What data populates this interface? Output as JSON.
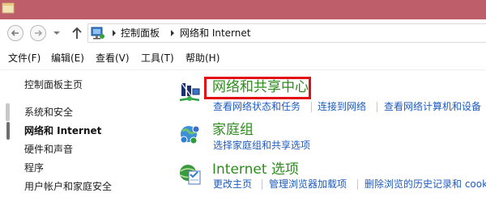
{
  "window": {
    "title_bar_color": "#bf5e6b"
  },
  "navigation": {
    "back_icon": "back-arrow-icon",
    "forward_icon": "forward-arrow-icon",
    "up_icon": "up-arrow-icon",
    "breadcrumbs": [
      "控制面板",
      "网络和 Internet"
    ]
  },
  "menu": {
    "items": [
      "文件(F)",
      "编辑(E)",
      "查看(V)",
      "工具(T)",
      "帮助(H)"
    ]
  },
  "sidebar": {
    "items": [
      "控制面板主页",
      "系统和安全",
      "网络和 Internet",
      "硬件和声音",
      "程序",
      "用户帐户和家庭安全"
    ],
    "selected": "网络和 Internet"
  },
  "main": {
    "categories": [
      {
        "title": "网络和共享中心",
        "icon": "network-center-icon",
        "highlighted": true,
        "links": [
          "查看网络状态和任务",
          "连接到网络",
          "查看网络计算机和设备"
        ]
      },
      {
        "title": "家庭组",
        "icon": "homegroup-icon",
        "links": [
          "选择家庭组和共享选项"
        ]
      },
      {
        "title": "Internet 选项",
        "icon": "internet-options-icon",
        "links": [
          "更改主页",
          "管理浏览器加载项",
          "删除浏览的历史记录和 cook"
        ]
      }
    ]
  },
  "colors": {
    "category_title": "#2e8c1e",
    "link": "#1f5bbd",
    "highlight_border": "#e20f14"
  }
}
